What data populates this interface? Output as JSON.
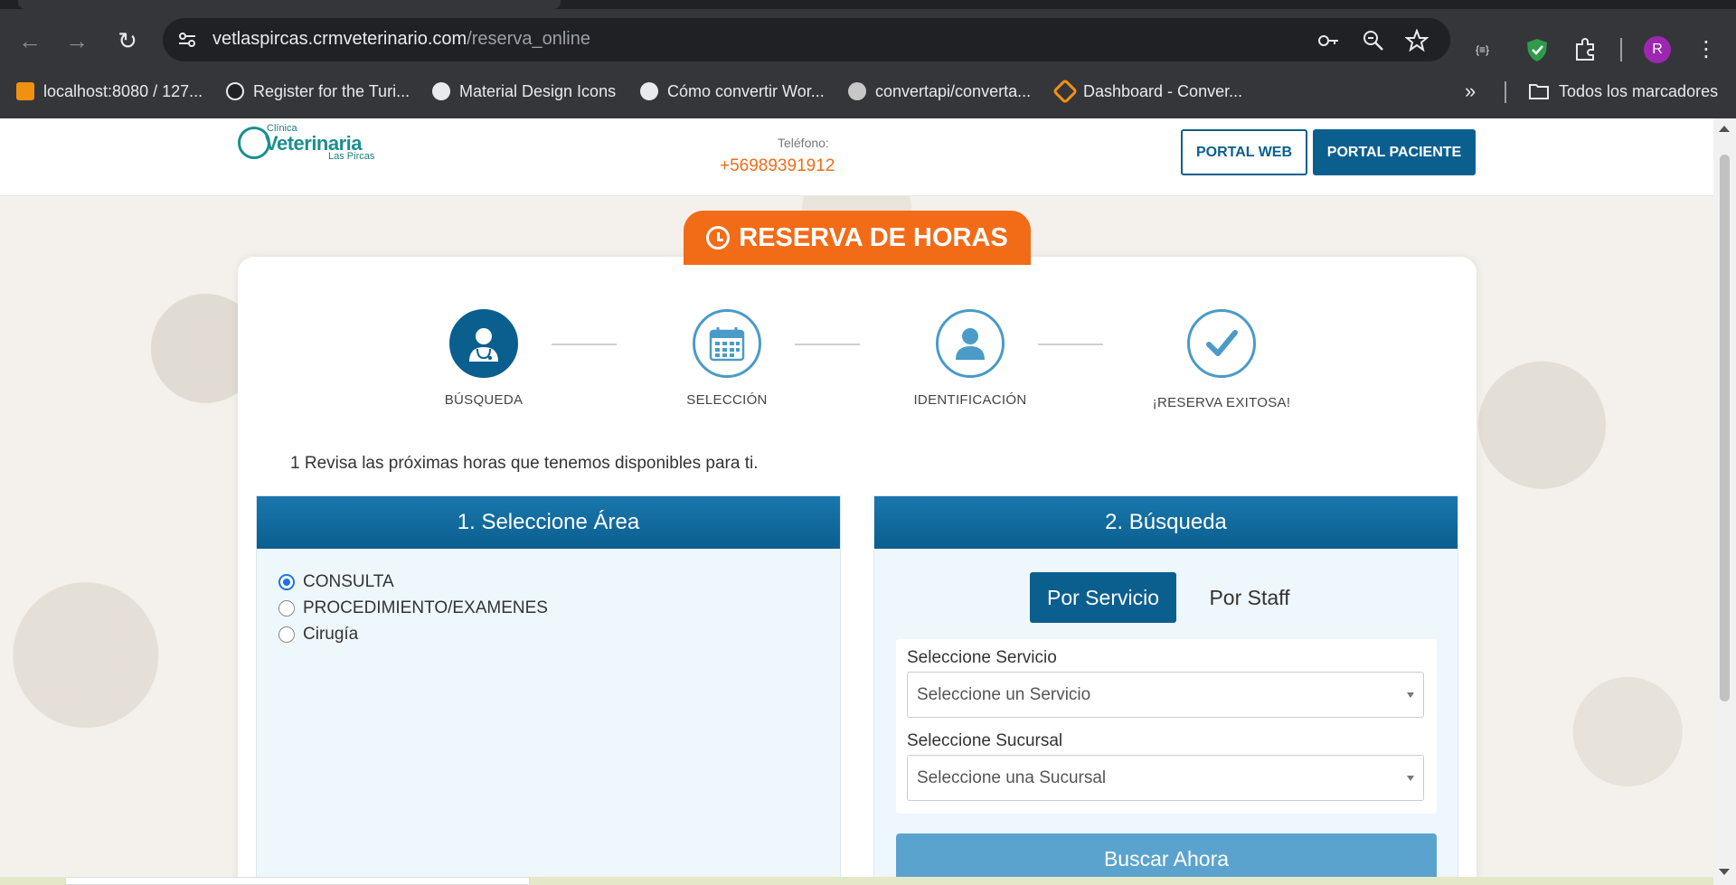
{
  "browser": {
    "url_domain": "vetlaspircas.crmveterinario.com",
    "url_path": "/reserva_online",
    "profile_initial": "R",
    "bookmarks": [
      {
        "label": "localhost:8080 / 127...",
        "icon": "phpmyadmin-icon"
      },
      {
        "label": "Register for the Turi...",
        "icon": "github-icon"
      },
      {
        "label": "Material Design Icons",
        "icon": "globe-icon"
      },
      {
        "label": "Cómo convertir Wor...",
        "icon": "globe-icon"
      },
      {
        "label": "convertapi/converta...",
        "icon": "convertapi-icon"
      },
      {
        "label": "Dashboard - Conver...",
        "icon": "dashboard-icon"
      }
    ],
    "all_bookmarks_label": "Todos los marcadores"
  },
  "header": {
    "logo_small": "Clínica",
    "logo_big": "Veterinaria",
    "logo_sub": "Las Pircas",
    "phone_label": "Teléfono:",
    "phone_number": "+56989391912",
    "portal_web": "PORTAL WEB",
    "portal_paciente": "PORTAL PACIENTE"
  },
  "title": "RESERVA DE HORAS",
  "steps": [
    {
      "label": "BÚSQUEDA",
      "icon": "doctor-icon",
      "active": true
    },
    {
      "label": "SELECCIÓN",
      "icon": "calendar-icon",
      "active": false
    },
    {
      "label": "IDENTIFICACIÓN",
      "icon": "user-icon",
      "active": false
    },
    {
      "label": "¡RESERVA EXITOSA!",
      "icon": "checkmark-icon",
      "active": false
    }
  ],
  "intro_text": "1 Revisa las próximas horas que tenemos disponibles para ti.",
  "area_panel": {
    "title": "1. Seleccione Área",
    "options": [
      {
        "label": "CONSULTA",
        "checked": true
      },
      {
        "label": "PROCEDIMIENTO/EXAMENES",
        "checked": false
      },
      {
        "label": "Cirugía",
        "checked": false
      }
    ]
  },
  "search_panel": {
    "title": "2. Búsqueda",
    "tab_service": "Por Servicio",
    "tab_staff": "Por Staff",
    "service_label": "Seleccione Servicio",
    "service_placeholder": "Seleccione un Servicio",
    "branch_label": "Seleccione Sucursal",
    "branch_placeholder": "Seleccione una Sucursal",
    "search_button": "Buscar Ahora"
  },
  "colors": {
    "primary": "#0a5f8f",
    "accent": "#f26c18",
    "panel_bg": "#eef7fc"
  }
}
